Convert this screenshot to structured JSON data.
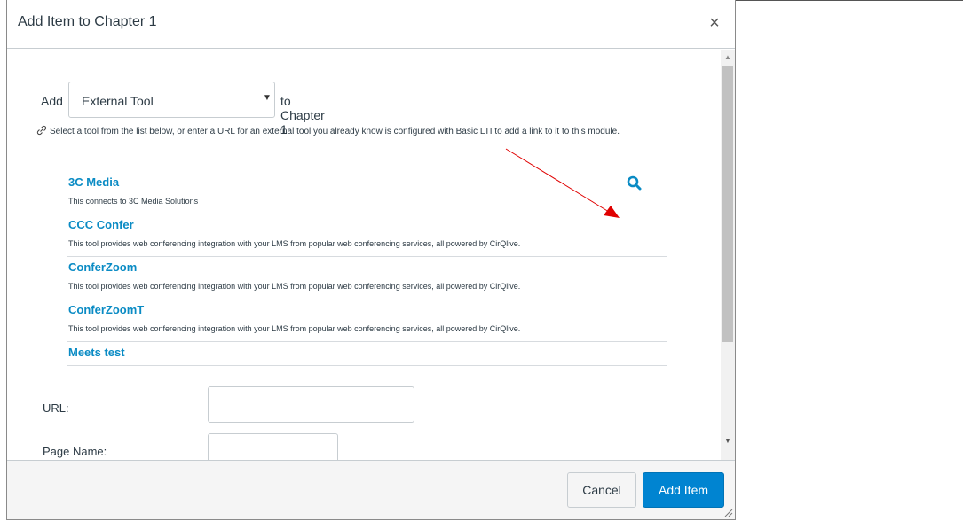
{
  "dialog": {
    "title": "Add Item to Chapter 1",
    "close_glyph": "×"
  },
  "add_row": {
    "add_label": "Add",
    "selected_type": "External Tool",
    "to_label": "to Chapter 1"
  },
  "help_text": "Select a tool from the list below, or enter a URL for an external tool you already know is configured with Basic LTI to add a link to it to this module.",
  "tools": [
    {
      "name": "3C Media",
      "description": "This connects to 3C Media Solutions"
    },
    {
      "name": "CCC Confer",
      "description": "This tool provides web conferencing integration with your LMS from popular web conferencing services, all powered by CirQlive."
    },
    {
      "name": "ConferZoom",
      "description": "This tool provides web conferencing integration with your LMS from popular web conferencing services, all powered by CirQlive."
    },
    {
      "name": "ConferZoomT",
      "description": "This tool provides web conferencing integration with your LMS from popular web conferencing services, all powered by CirQlive."
    },
    {
      "name": "Meets test",
      "description": ""
    }
  ],
  "form": {
    "url_label": "URL:",
    "url_value": "",
    "page_name_label": "Page Name:",
    "page_name_value": ""
  },
  "footer": {
    "cancel_label": "Cancel",
    "add_item_label": "Add Item"
  },
  "colors": {
    "link_blue": "#0a8bc4",
    "primary_button": "#0084d1",
    "annotation_arrow": "#e00000"
  },
  "icons": {
    "link": "link-icon",
    "search": "search-icon",
    "close": "close-icon",
    "dropdown": "caret-down-icon"
  }
}
